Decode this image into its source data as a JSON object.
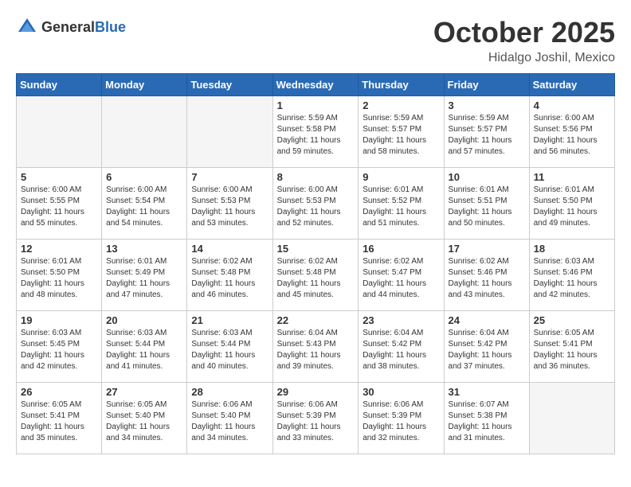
{
  "header": {
    "logo_general": "General",
    "logo_blue": "Blue",
    "month": "October 2025",
    "location": "Hidalgo Joshil, Mexico"
  },
  "weekdays": [
    "Sunday",
    "Monday",
    "Tuesday",
    "Wednesday",
    "Thursday",
    "Friday",
    "Saturday"
  ],
  "weeks": [
    [
      {
        "day": "",
        "empty": true
      },
      {
        "day": "",
        "empty": true
      },
      {
        "day": "",
        "empty": true
      },
      {
        "day": "1",
        "sunrise": "Sunrise: 5:59 AM",
        "sunset": "Sunset: 5:58 PM",
        "daylight": "Daylight: 11 hours and 59 minutes."
      },
      {
        "day": "2",
        "sunrise": "Sunrise: 5:59 AM",
        "sunset": "Sunset: 5:57 PM",
        "daylight": "Daylight: 11 hours and 58 minutes."
      },
      {
        "day": "3",
        "sunrise": "Sunrise: 5:59 AM",
        "sunset": "Sunset: 5:57 PM",
        "daylight": "Daylight: 11 hours and 57 minutes."
      },
      {
        "day": "4",
        "sunrise": "Sunrise: 6:00 AM",
        "sunset": "Sunset: 5:56 PM",
        "daylight": "Daylight: 11 hours and 56 minutes."
      }
    ],
    [
      {
        "day": "5",
        "sunrise": "Sunrise: 6:00 AM",
        "sunset": "Sunset: 5:55 PM",
        "daylight": "Daylight: 11 hours and 55 minutes."
      },
      {
        "day": "6",
        "sunrise": "Sunrise: 6:00 AM",
        "sunset": "Sunset: 5:54 PM",
        "daylight": "Daylight: 11 hours and 54 minutes."
      },
      {
        "day": "7",
        "sunrise": "Sunrise: 6:00 AM",
        "sunset": "Sunset: 5:53 PM",
        "daylight": "Daylight: 11 hours and 53 minutes."
      },
      {
        "day": "8",
        "sunrise": "Sunrise: 6:00 AM",
        "sunset": "Sunset: 5:53 PM",
        "daylight": "Daylight: 11 hours and 52 minutes."
      },
      {
        "day": "9",
        "sunrise": "Sunrise: 6:01 AM",
        "sunset": "Sunset: 5:52 PM",
        "daylight": "Daylight: 11 hours and 51 minutes."
      },
      {
        "day": "10",
        "sunrise": "Sunrise: 6:01 AM",
        "sunset": "Sunset: 5:51 PM",
        "daylight": "Daylight: 11 hours and 50 minutes."
      },
      {
        "day": "11",
        "sunrise": "Sunrise: 6:01 AM",
        "sunset": "Sunset: 5:50 PM",
        "daylight": "Daylight: 11 hours and 49 minutes."
      }
    ],
    [
      {
        "day": "12",
        "sunrise": "Sunrise: 6:01 AM",
        "sunset": "Sunset: 5:50 PM",
        "daylight": "Daylight: 11 hours and 48 minutes."
      },
      {
        "day": "13",
        "sunrise": "Sunrise: 6:01 AM",
        "sunset": "Sunset: 5:49 PM",
        "daylight": "Daylight: 11 hours and 47 minutes."
      },
      {
        "day": "14",
        "sunrise": "Sunrise: 6:02 AM",
        "sunset": "Sunset: 5:48 PM",
        "daylight": "Daylight: 11 hours and 46 minutes."
      },
      {
        "day": "15",
        "sunrise": "Sunrise: 6:02 AM",
        "sunset": "Sunset: 5:48 PM",
        "daylight": "Daylight: 11 hours and 45 minutes."
      },
      {
        "day": "16",
        "sunrise": "Sunrise: 6:02 AM",
        "sunset": "Sunset: 5:47 PM",
        "daylight": "Daylight: 11 hours and 44 minutes."
      },
      {
        "day": "17",
        "sunrise": "Sunrise: 6:02 AM",
        "sunset": "Sunset: 5:46 PM",
        "daylight": "Daylight: 11 hours and 43 minutes."
      },
      {
        "day": "18",
        "sunrise": "Sunrise: 6:03 AM",
        "sunset": "Sunset: 5:46 PM",
        "daylight": "Daylight: 11 hours and 42 minutes."
      }
    ],
    [
      {
        "day": "19",
        "sunrise": "Sunrise: 6:03 AM",
        "sunset": "Sunset: 5:45 PM",
        "daylight": "Daylight: 11 hours and 42 minutes."
      },
      {
        "day": "20",
        "sunrise": "Sunrise: 6:03 AM",
        "sunset": "Sunset: 5:44 PM",
        "daylight": "Daylight: 11 hours and 41 minutes."
      },
      {
        "day": "21",
        "sunrise": "Sunrise: 6:03 AM",
        "sunset": "Sunset: 5:44 PM",
        "daylight": "Daylight: 11 hours and 40 minutes."
      },
      {
        "day": "22",
        "sunrise": "Sunrise: 6:04 AM",
        "sunset": "Sunset: 5:43 PM",
        "daylight": "Daylight: 11 hours and 39 minutes."
      },
      {
        "day": "23",
        "sunrise": "Sunrise: 6:04 AM",
        "sunset": "Sunset: 5:42 PM",
        "daylight": "Daylight: 11 hours and 38 minutes."
      },
      {
        "day": "24",
        "sunrise": "Sunrise: 6:04 AM",
        "sunset": "Sunset: 5:42 PM",
        "daylight": "Daylight: 11 hours and 37 minutes."
      },
      {
        "day": "25",
        "sunrise": "Sunrise: 6:05 AM",
        "sunset": "Sunset: 5:41 PM",
        "daylight": "Daylight: 11 hours and 36 minutes."
      }
    ],
    [
      {
        "day": "26",
        "sunrise": "Sunrise: 6:05 AM",
        "sunset": "Sunset: 5:41 PM",
        "daylight": "Daylight: 11 hours and 35 minutes."
      },
      {
        "day": "27",
        "sunrise": "Sunrise: 6:05 AM",
        "sunset": "Sunset: 5:40 PM",
        "daylight": "Daylight: 11 hours and 34 minutes."
      },
      {
        "day": "28",
        "sunrise": "Sunrise: 6:06 AM",
        "sunset": "Sunset: 5:40 PM",
        "daylight": "Daylight: 11 hours and 34 minutes."
      },
      {
        "day": "29",
        "sunrise": "Sunrise: 6:06 AM",
        "sunset": "Sunset: 5:39 PM",
        "daylight": "Daylight: 11 hours and 33 minutes."
      },
      {
        "day": "30",
        "sunrise": "Sunrise: 6:06 AM",
        "sunset": "Sunset: 5:39 PM",
        "daylight": "Daylight: 11 hours and 32 minutes."
      },
      {
        "day": "31",
        "sunrise": "Sunrise: 6:07 AM",
        "sunset": "Sunset: 5:38 PM",
        "daylight": "Daylight: 11 hours and 31 minutes."
      },
      {
        "day": "",
        "empty": true
      }
    ]
  ]
}
